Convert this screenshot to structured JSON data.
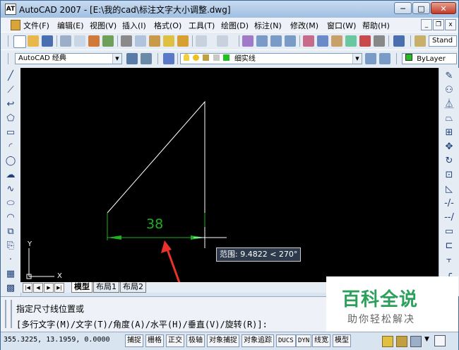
{
  "window": {
    "title": "AutoCAD 2007 - [E:\\我的cad\\标注文字大小调整.dwg]",
    "app_icon_label": "AT",
    "controls": [
      "─",
      "□",
      "✕"
    ]
  },
  "menu": {
    "items": [
      "文件(F)",
      "编辑(E)",
      "视图(V)",
      "插入(I)",
      "格式(O)",
      "工具(T)",
      "绘图(D)",
      "标注(N)",
      "修改(M)",
      "窗口(W)",
      "帮助(H)"
    ],
    "mdi_controls": [
      "_",
      "❐",
      "x"
    ]
  },
  "toolbar": {
    "style_right_label": "Stand",
    "workspace": "AutoCAD 经典",
    "layer": "细实线",
    "color": "ByLayer"
  },
  "drawing": {
    "dimension_text": "38",
    "tooltip": "范围: 9.4822 < 270°",
    "ucs_x": "X",
    "ucs_y": "Y"
  },
  "tabs": {
    "nav": [
      "|◀",
      "◀",
      "▶",
      "▶|"
    ],
    "items": [
      "模型",
      "布局1",
      "布局2"
    ]
  },
  "command": {
    "line1": "指定尺寸线位置或",
    "line2": "[多行文字(M)/文字(T)/角度(A)/水平(H)/垂直(V)/旋转(R)]:"
  },
  "status": {
    "coords": "355.3225, 13.1959, 0.0000",
    "buttons": [
      "捕捉",
      "栅格",
      "正交",
      "极轴",
      "对象捕捉",
      "对象追踪",
      "DUCS",
      "DYN",
      "线宽",
      "模型"
    ]
  },
  "watermark": {
    "line1": "百科全说",
    "line2": "助你轻松解决"
  },
  "colors": {
    "canvas": "#000000",
    "geometry": "#ffffff",
    "dimension": "#1fb01f",
    "arrow": "#e8322b"
  }
}
